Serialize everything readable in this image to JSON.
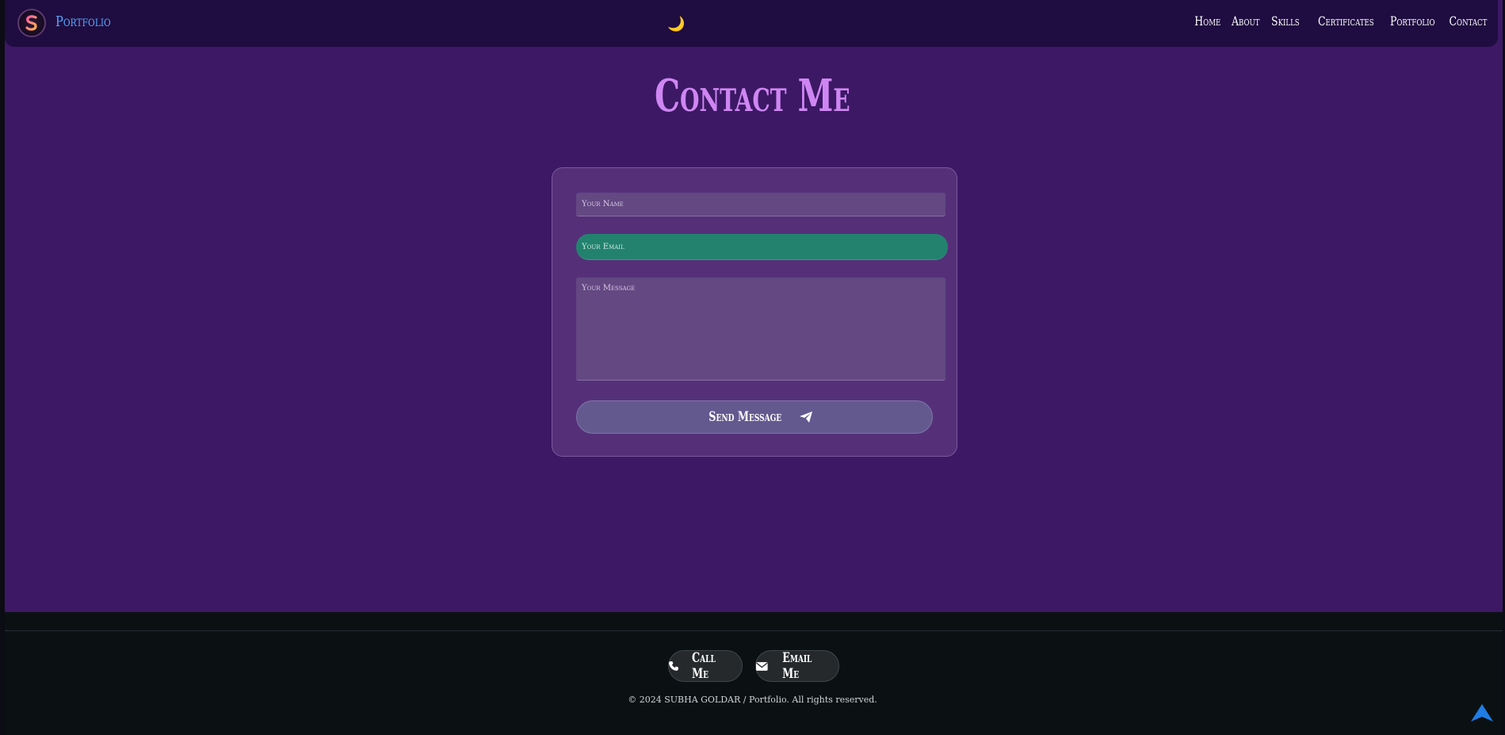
{
  "navbar": {
    "brand": "Portfolio",
    "theme_icon": "moon-icon",
    "links": [
      "Home",
      "About",
      "Skills",
      "Certificates",
      "Portfolio",
      "Contact"
    ]
  },
  "contact": {
    "title": "Contact Me",
    "name_placeholder": "Your Name",
    "email_placeholder": "Your Email",
    "message_placeholder": "Your Message",
    "send_label": "Send Message",
    "send_icon": "paper-plane-icon"
  },
  "footer": {
    "call_label": "Call Me",
    "call_icon": "phone-icon",
    "email_label": "Email Me",
    "email_icon": "envelope-icon",
    "copyright": "© 2024 SUBHA GOLDAR / Portfolio. All rights reserved.",
    "scroll_top_icon": "arrow-up-icon"
  },
  "colors": {
    "page_bg": "#3c1865",
    "navbar_bg": "#1f0c40",
    "title": "#cf86f2",
    "brand": "#59a8ff",
    "email_field": "#23826e",
    "footer_bg": "#0b1113",
    "scroll_top": "#1e7de6"
  }
}
